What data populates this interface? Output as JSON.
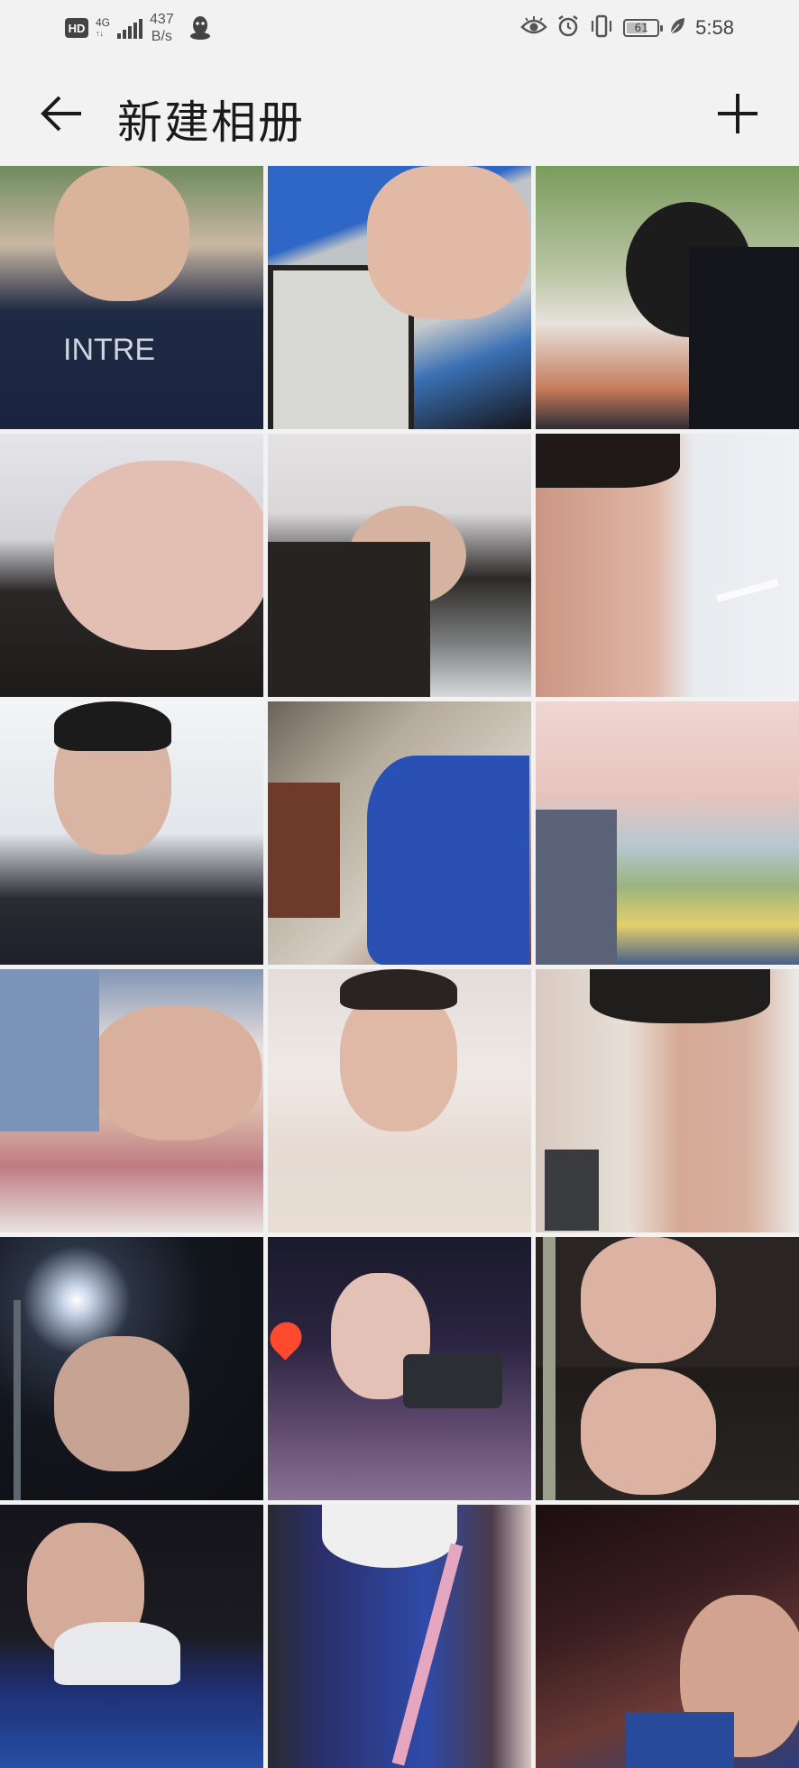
{
  "status_bar": {
    "hd": "HD",
    "net_type": "4G",
    "net_sub": "↑↓",
    "speed_value": "437",
    "speed_unit": "B/s",
    "battery": "61",
    "time": "5:58"
  },
  "app_bar": {
    "title": "新建相册"
  },
  "colors": {
    "background": "#f2f2f2",
    "icon": "#1a1a1a"
  },
  "photos": [
    {
      "name": "photo-boy-eating-snack"
    },
    {
      "name": "photo-phone-in-hand"
    },
    {
      "name": "photo-boy-outdoor-table"
    },
    {
      "name": "photo-sleeping-closeup"
    },
    {
      "name": "photo-sleeping-on-desk"
    },
    {
      "name": "photo-selfie-closeup"
    },
    {
      "name": "photo-boy-classroom"
    },
    {
      "name": "photo-lying-on-ground"
    },
    {
      "name": "photo-two-friends-hug"
    },
    {
      "name": "photo-boy-lying-down"
    },
    {
      "name": "photo-boy-white-shirt"
    },
    {
      "name": "photo-boy-cafeteria"
    },
    {
      "name": "photo-night-streetlight"
    },
    {
      "name": "photo-couple-phone-selfie"
    },
    {
      "name": "photo-double-portrait"
    },
    {
      "name": "photo-night-blue-hoodie"
    },
    {
      "name": "photo-blue-hoodie-back"
    },
    {
      "name": "photo-night-smile"
    }
  ]
}
